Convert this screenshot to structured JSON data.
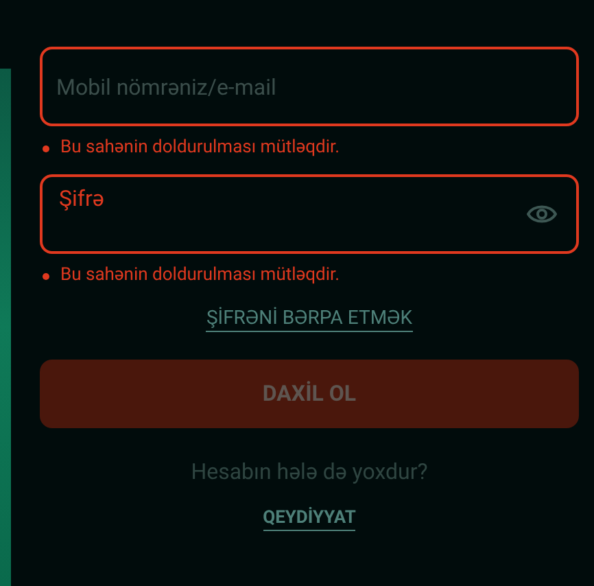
{
  "fields": [
    {
      "kind": "text",
      "placeholder": "Mobil nömrəniz/e-mail",
      "invalid": true,
      "error": "Bu sahənin doldurulması mütləqdir."
    },
    {
      "kind": "password",
      "label": "Şifrə",
      "invalid": true,
      "error": "Bu sahənin doldurulması mütləqdir."
    }
  ],
  "forgot_link": "ŞİFRƏNİ BƏRPA ETMƏK",
  "submit": {
    "label": "DAXİL OL",
    "disabled": true
  },
  "signup_prompt": "Hesabın hələ də yoxdur?",
  "signup_link": "QEYDİYYAT"
}
